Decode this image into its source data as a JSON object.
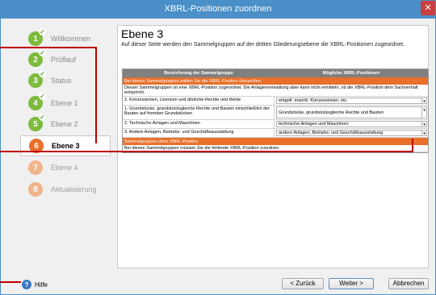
{
  "window": {
    "title": "XBRL-Positionen zuordnen"
  },
  "nav": {
    "steps": [
      {
        "num": "1",
        "label": "Willkommen",
        "state": "done"
      },
      {
        "num": "2",
        "label": "Prüflauf",
        "state": "done"
      },
      {
        "num": "3",
        "label": "Status",
        "state": "done"
      },
      {
        "num": "4",
        "label": "Ebene 1",
        "state": "done"
      },
      {
        "num": "5",
        "label": "Ebene 2",
        "state": "done"
      },
      {
        "num": "6",
        "label": "Ebene 3",
        "state": "active"
      },
      {
        "num": "7",
        "label": "Ebene 4",
        "state": "todo"
      },
      {
        "num": "8",
        "label": "Aktualisierung",
        "state": "todo"
      }
    ]
  },
  "page": {
    "title": "Ebene 3",
    "description": "Auf dieser Seite werden den Sammelgruppen auf der dritten Gliederungsebene die XBRL-Positionen zugeordnet."
  },
  "grid": {
    "col1": "Bezeichnung der Sammelgruppe",
    "col2": "Mögliche XBRL-Positionen",
    "section1_header": "Bei diesen Sammelgruppen sollten Sie die XBRL-Position überprüfen.",
    "section1_note": "Diesen Sammelgruppen ist eine XBRL-Position zugeordnet. Die Anlagenverwaltung aber kann nicht ermitteln, ob die XBRL-Position dem Sachverhalt entspricht.",
    "rows": [
      {
        "name": "2. Konzessionen, Lizenzen und ähnliche Rechte und Werte",
        "value": "entgelt. erworb. Konzessionen, etc."
      },
      {
        "name": "1. Grundstücke, grundstücksgleiche Rechte und Bauten einschließlich der Bauten auf fremden Grundstücken",
        "value": "Grundstücke, grundstücksgleiche Rechte und Bauten"
      },
      {
        "name": "2. Technische Anlagen und Maschinen",
        "value": "technische Anlagen und Maschinen"
      },
      {
        "name": "3. Andere Anlagen, Betriebs- und Geschäftsausstattung",
        "value": "andere Anlagen, Betriebs- und Geschäftsausstattung"
      }
    ],
    "section2_header": "Sammelgruppen ohne XBRL-Position",
    "section2_note": "Bei diesen Sammelgruppen müssen Sie die fehlende XBRL-Position zuordnen."
  },
  "footer": {
    "help": "Hilfe",
    "back": "< Zurück",
    "next": "Weiter >",
    "cancel": "Abbrechen"
  },
  "colors": {
    "accent": "#e8702a",
    "done": "#7dbb3c",
    "titlebar": "#4a8fc8",
    "callout": "#c00000"
  }
}
